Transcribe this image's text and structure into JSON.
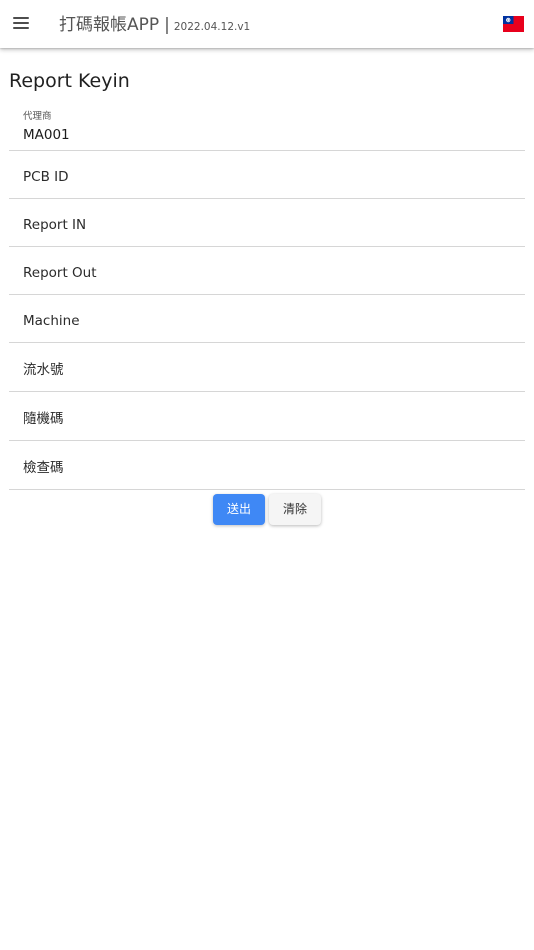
{
  "appbar": {
    "menu_icon": "hamburger-menu-icon",
    "title": "打碼報帳APP",
    "separator": "|",
    "version": "2022.04.12.v1",
    "flag_icon": "taiwan-flag-icon"
  },
  "page": {
    "title": "Report Keyin"
  },
  "form": {
    "fields": [
      {
        "label": "代理商",
        "value": "MA001"
      },
      {
        "label": "PCB ID",
        "value": ""
      },
      {
        "label": "Report IN",
        "value": ""
      },
      {
        "label": "Report Out",
        "value": ""
      },
      {
        "label": "Machine",
        "value": ""
      },
      {
        "label": "流水號",
        "value": ""
      },
      {
        "label": "隨機碼",
        "value": ""
      },
      {
        "label": "檢查碼",
        "value": ""
      }
    ]
  },
  "actions": {
    "submit_label": "送出",
    "clear_label": "清除"
  },
  "colors": {
    "primary": "#3f88f5",
    "flag_red": "#e8001c",
    "flag_blue": "#0032a0"
  }
}
